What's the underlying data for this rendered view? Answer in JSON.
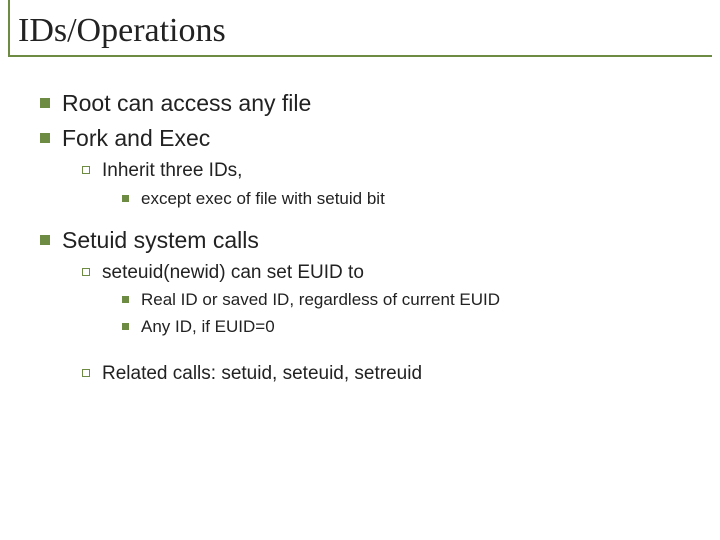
{
  "title": "IDs/Operations",
  "items": [
    {
      "text": "Root can access any file"
    },
    {
      "text": "Fork and Exec",
      "children": [
        {
          "text": "Inherit three IDs,",
          "children": [
            {
              "text": "except exec of file with setuid bit"
            }
          ]
        }
      ]
    },
    {
      "text": "Setuid system calls",
      "children": [
        {
          "text": "seteuid(newid) can set EUID to",
          "children": [
            {
              "text": "Real ID or saved ID, regardless of current EUID"
            },
            {
              "text": "Any ID, if EUID=0"
            }
          ]
        },
        {
          "text": "Related calls: setuid, seteuid, setreuid"
        }
      ]
    }
  ]
}
